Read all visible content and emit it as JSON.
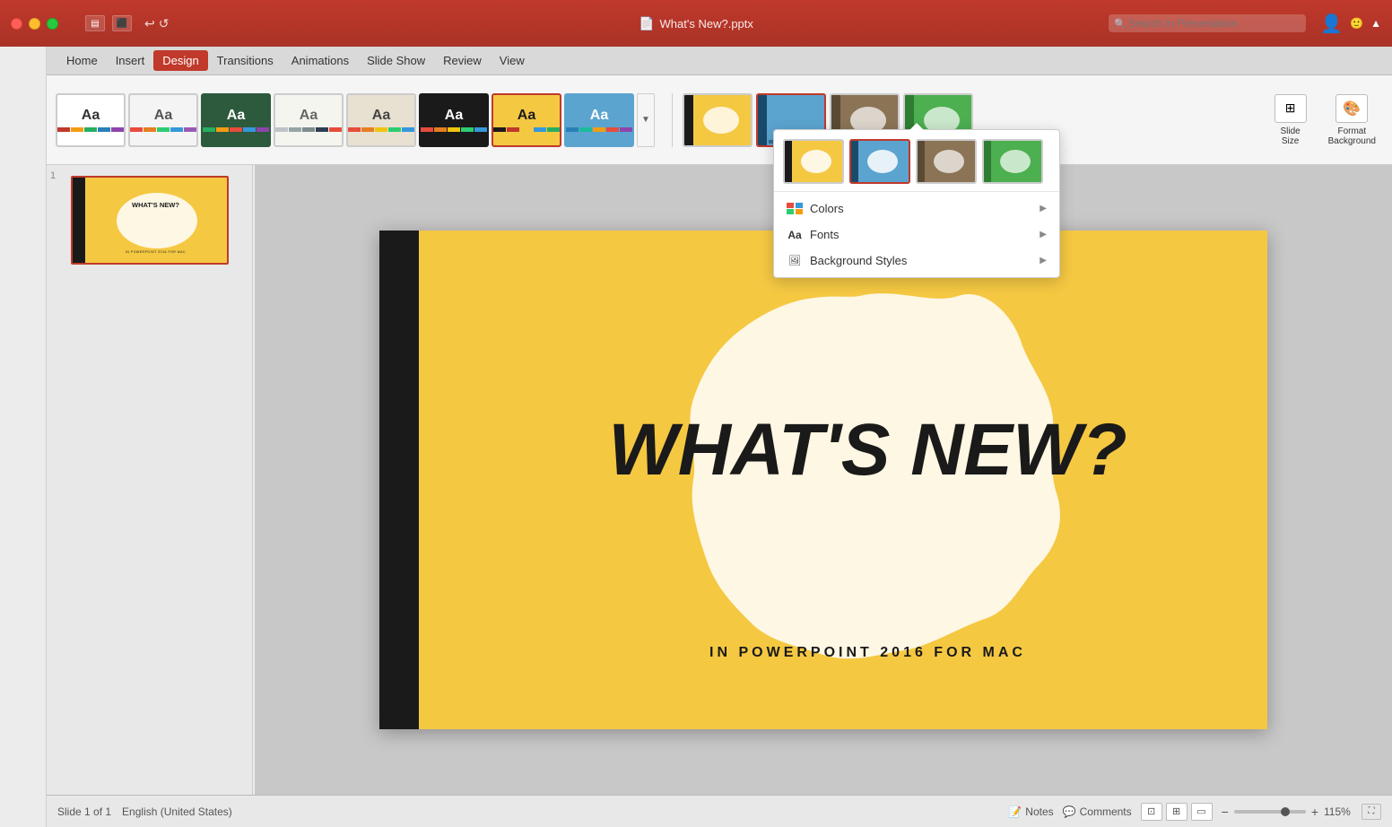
{
  "app": {
    "title": "What's New?.pptx",
    "window_controls": [
      "red",
      "yellow",
      "green"
    ]
  },
  "titlebar": {
    "doc_title": "What's New?.pptx",
    "search_placeholder": "Search in Presentation",
    "undo_icon": "↩",
    "redo_icon": "↺"
  },
  "menubar": {
    "items": [
      "Home",
      "Insert",
      "Design",
      "Transitions",
      "Animations",
      "Slide Show",
      "Review",
      "View"
    ],
    "active": "Design"
  },
  "ribbon": {
    "themes": [
      {
        "id": "t1",
        "label": "Aa",
        "bg": "#ffffff",
        "colors": [
          "#c0392b",
          "#f39c12",
          "#27ae60",
          "#2980b9",
          "#8e44ad"
        ]
      },
      {
        "id": "t2",
        "label": "Aa",
        "bg": "#f4f4f4",
        "colors": [
          "#e74c3c",
          "#e67e22",
          "#2ecc71",
          "#3498db",
          "#9b59b6"
        ]
      },
      {
        "id": "t3",
        "label": "Aa",
        "bg": "#2d5a3d",
        "colors": [
          "#27ae60",
          "#f39c12",
          "#e74c3c",
          "#3498db",
          "#8e44ad"
        ]
      },
      {
        "id": "t4",
        "label": "Aa",
        "bg": "#f5f5f0",
        "colors": [
          "#bdc3c7",
          "#95a5a6",
          "#7f8c8d",
          "#2c3e50",
          "#e74c3c"
        ]
      },
      {
        "id": "t5",
        "label": "Aa",
        "bg": "#e8e0d0",
        "colors": [
          "#e74c3c",
          "#e67e22",
          "#f1c40f",
          "#2ecc71",
          "#3498db"
        ]
      },
      {
        "id": "t6",
        "label": "Aa",
        "bg": "#1a1a1a",
        "colors": [
          "#e74c3c",
          "#e67e22",
          "#f1c40f",
          "#2ecc71",
          "#3498db"
        ]
      },
      {
        "id": "t7",
        "label": "Aa",
        "bg": "#f5c842",
        "selected": true,
        "colors": [
          "#1a1a1a",
          "#c0392b",
          "#f5c842",
          "#3498db",
          "#27ae60"
        ]
      },
      {
        "id": "t8",
        "label": "Aa",
        "bg": "#5ba4cf",
        "colors": [
          "#2980b9",
          "#1abc9c",
          "#f39c12",
          "#e74c3c",
          "#8e44ad"
        ]
      }
    ],
    "slide_size_label": "Slide\nSize",
    "format_bg_label": "Format\nBackground"
  },
  "variant_themes": [
    {
      "id": "v1",
      "bg": "#f5c842",
      "selected": false
    },
    {
      "id": "v2",
      "bg": "#5ba4cf",
      "selected": true
    },
    {
      "id": "v3",
      "bg": "#8b8060",
      "selected": false
    },
    {
      "id": "v4",
      "bg": "#4caf50",
      "selected": false
    }
  ],
  "dropdown": {
    "thumbs": [
      {
        "id": "d1",
        "bg": "#f5c842",
        "selected": false
      },
      {
        "id": "d2",
        "bg": "#5ba4cf",
        "selected": true
      },
      {
        "id": "d3",
        "bg": "#8b8060",
        "selected": false
      },
      {
        "id": "d4",
        "bg": "#4caf50",
        "selected": false
      }
    ],
    "menu_items": [
      {
        "label": "Colors",
        "icon": "grid",
        "has_arrow": true
      },
      {
        "label": "Fonts",
        "prefix": "Aa",
        "has_arrow": true
      },
      {
        "label": "Background Styles",
        "icon": "bg",
        "has_arrow": true
      }
    ]
  },
  "slide": {
    "number": "1",
    "main_title": "WHAT'S NEW?",
    "subtitle": "IN POWERPOINT 2016 FOR MAC",
    "bg_color": "#f5c842",
    "stripe_color": "#1a1a1a"
  },
  "statusbar": {
    "slide_info": "Slide 1 of 1",
    "language": "English (United States)",
    "notes_label": "Notes",
    "comments_label": "Comments",
    "zoom_level": "115%",
    "zoom_minus": "−",
    "zoom_plus": "+"
  }
}
